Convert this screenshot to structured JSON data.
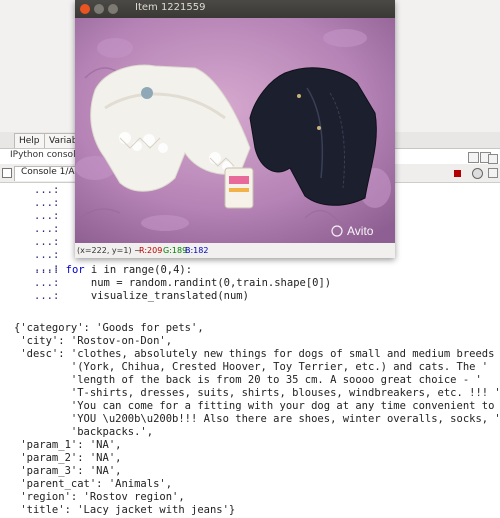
{
  "window": {
    "title": "Item 1221559",
    "status": {
      "coords": "(x=222, y=1) ~",
      "r": "R:209",
      "g": "G:189",
      "b": "B:182"
    },
    "watermark": "Avito"
  },
  "ide": {
    "tabs": [
      "Help",
      "Variable"
    ],
    "panel_title": "IPython console",
    "console_tab": "Console 1/A"
  },
  "console": {
    "continuation_prompts": [
      "...:",
      "...:",
      "...:",
      "...:",
      "...:",
      "...:",
      "...:"
    ],
    "code": [
      {
        "prompt": "...:",
        "kw": "for",
        "rest": " i in range(0,4):"
      },
      {
        "prompt": "...:",
        "kw": "",
        "rest": "    num = random.randint(0,train.shape[0])"
      },
      {
        "prompt": "...:",
        "kw": "",
        "rest": "    visualize_translated(num)"
      }
    ],
    "output": [
      "{'category': 'Goods for pets',",
      " 'city': 'Rostov-on-Don',",
      " 'desc': 'clothes, absolutely new things for dogs of small and medium breeds '",
      "         '(York, Chihua, Crested Hoover, Toy Terrier, etc.) and cats. The '",
      "         'length of the back is from 20 to 35 cm. A soooo great choice - '",
      "         'T-shirts, dresses, suits, shirts, blouses, windbreakers, etc. !!! '",
      "         'You can come for a fitting with your dog at any time convenient to '",
      "         'YOU \\u200b\\u200b!!! Also there are shoes, winter overalls, socks, '",
      "         'backpacks.',",
      " 'param_1': 'NA',",
      " 'param_2': 'NA',",
      " 'param_3': 'NA',",
      " 'parent_cat': 'Animals',",
      " 'region': 'Rostov region',",
      " 'title': 'Lacy jacket with jeans'}"
    ]
  },
  "colors": {
    "window_bg": "#3c3b37",
    "close_btn": "#e95420",
    "photo_bg": "#b48ab4"
  }
}
